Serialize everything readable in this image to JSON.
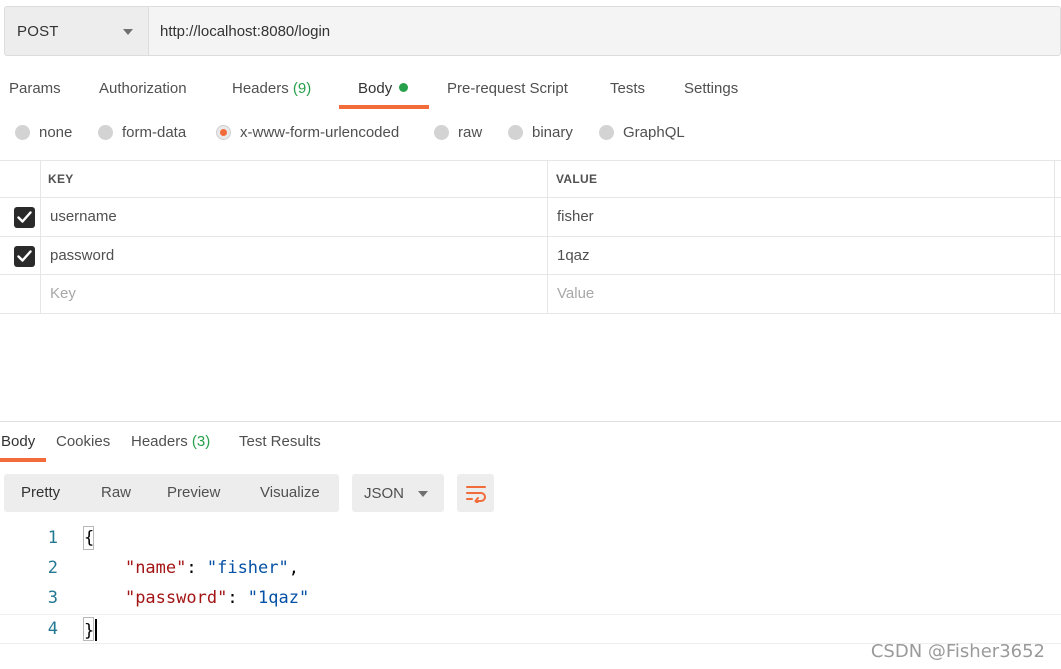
{
  "request": {
    "method": "POST",
    "url": "http://localhost:8080/login"
  },
  "request_tabs": {
    "params": "Params",
    "authorization": "Authorization",
    "headers_label": "Headers",
    "headers_count": "(9)",
    "body": "Body",
    "prerequest": "Pre-request Script",
    "tests": "Tests",
    "settings": "Settings"
  },
  "body_types": {
    "none": "none",
    "form_data": "form-data",
    "urlencoded": "x-www-form-urlencoded",
    "raw": "raw",
    "binary": "binary",
    "graphql": "GraphQL",
    "selected": "x-www-form-urlencoded"
  },
  "kv_table": {
    "header_key": "KEY",
    "header_value": "VALUE",
    "rows": [
      {
        "key": "username",
        "value": "fisher",
        "checked": true
      },
      {
        "key": "password",
        "value": "1qaz",
        "checked": true
      }
    ],
    "placeholder_key": "Key",
    "placeholder_value": "Value"
  },
  "response_tabs": {
    "body": "Body",
    "cookies": "Cookies",
    "headers_label": "Headers",
    "headers_count": "(3)",
    "test_results": "Test Results"
  },
  "view_modes": {
    "pretty": "Pretty",
    "raw": "Raw",
    "preview": "Preview",
    "visualize": "Visualize",
    "format": "JSON"
  },
  "code": {
    "line_numbers": [
      "1",
      "2",
      "3",
      "4"
    ],
    "open_brace": "{",
    "indent": "    ",
    "name_key": "\"name\"",
    "name_value": "\"fisher\"",
    "password_key": "\"password\"",
    "password_value": "\"1qaz\"",
    "colon": ": ",
    "comma": ",",
    "close_brace": "}"
  },
  "colors": {
    "accent": "#f26b3a",
    "success": "#26a04a"
  },
  "watermark": "CSDN @Fisher3652"
}
